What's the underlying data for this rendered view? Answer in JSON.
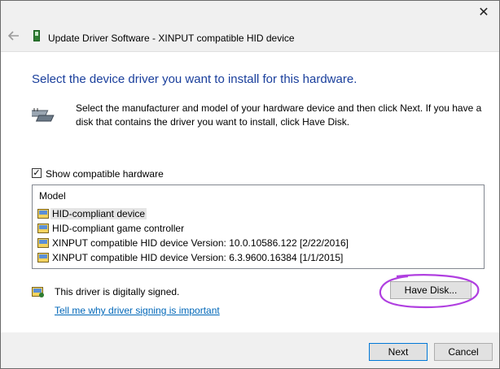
{
  "header": {
    "title": "Update Driver Software - XINPUT compatible HID device"
  },
  "heading": "Select the device driver you want to install for this hardware.",
  "intro": "Select the manufacturer and model of your hardware device and then click Next. If you have a disk that contains the driver you want to install, click Have Disk.",
  "show_compatible": {
    "label": "Show compatible hardware",
    "checked": true
  },
  "list": {
    "header": "Model",
    "items": [
      "HID-compliant device",
      "HID-compliant game controller",
      "XINPUT compatible HID device Version: 10.0.10586.122 [2/22/2016]",
      "XINPUT compatible HID device Version: 6.3.9600.16384 [1/1/2015]"
    ]
  },
  "signed_text": "This driver is digitally signed.",
  "signing_link": "Tell me why driver signing is important",
  "buttons": {
    "have_disk": "Have Disk...",
    "next": "Next",
    "cancel": "Cancel"
  },
  "colors": {
    "heading": "#1a3f9c",
    "link": "#0067b8",
    "annotation": "#b03fe0"
  }
}
